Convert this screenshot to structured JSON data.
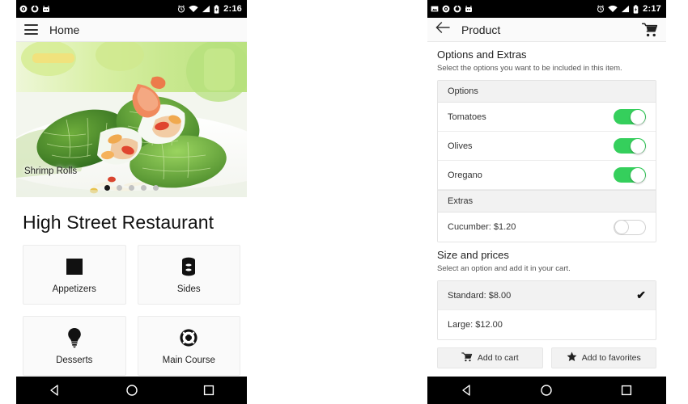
{
  "theme": {
    "toggle_on_color": "#35cf5c",
    "toggle_off_color": "#d2d2d2",
    "statusbar_color": "#000000",
    "card_header_bg": "#f2f2f2",
    "page_bg": "#ffffff"
  },
  "left_screen": {
    "statusbar": {
      "time": "2:16",
      "left_icons": [
        "notification-circle-icon",
        "notification-target-icon",
        "notification-robot-icon"
      ],
      "right_icons": [
        "alarm-icon",
        "wifi-icon",
        "signal-icon",
        "battery-icon"
      ]
    },
    "appbar": {
      "menu_icon": "hamburger-icon",
      "title": "Home"
    },
    "hero": {
      "caption": "Shrimp Rolls",
      "dot_count": 5,
      "active_dot": 1
    },
    "restaurant_title": "High Street Restaurant",
    "categories": [
      {
        "label": "Appetizers",
        "icon": "square-icon"
      },
      {
        "label": "Sides",
        "icon": "database-icon"
      },
      {
        "label": "Desserts",
        "icon": "lightbulb-icon"
      },
      {
        "label": "Main Course",
        "icon": "lifebuoy-icon"
      }
    ],
    "navbar": [
      "back-icon",
      "home-icon",
      "recents-icon"
    ]
  },
  "right_screen": {
    "statusbar": {
      "time": "2:17",
      "left_icons": [
        "notification-image-icon",
        "notification-circle-icon",
        "notification-target-icon",
        "notification-robot-icon"
      ],
      "right_icons": [
        "alarm-icon",
        "wifi-icon",
        "signal-icon",
        "battery-icon"
      ]
    },
    "appbar": {
      "back_icon": "arrow-left-icon",
      "title": "Product",
      "cart_icon": "shopping-cart-icon"
    },
    "options_section": {
      "heading": "Options and Extras",
      "subtitle": "Select the options you want to be included in this item.",
      "options_group_label": "Options",
      "options": [
        {
          "label": "Tomatoes",
          "state": "on"
        },
        {
          "label": "Olives",
          "state": "on"
        },
        {
          "label": "Oregano",
          "state": "on"
        }
      ],
      "extras_group_label": "Extras",
      "extras": [
        {
          "label": "Cucumber: $1.20",
          "state": "off"
        }
      ]
    },
    "size_section": {
      "heading": "Size and prices",
      "subtitle": "Select an option and add it in your cart.",
      "prices": [
        {
          "label": "Standard: $8.00",
          "selected": true,
          "check": "✔"
        },
        {
          "label": "Large: $12.00",
          "selected": false,
          "check": ""
        }
      ]
    },
    "actions": [
      {
        "label": "Add to cart",
        "icon": "shopping-cart-icon"
      },
      {
        "label": "Add to favorites",
        "icon": "star-icon"
      }
    ],
    "navbar": [
      "back-icon",
      "home-icon",
      "recents-icon"
    ]
  }
}
